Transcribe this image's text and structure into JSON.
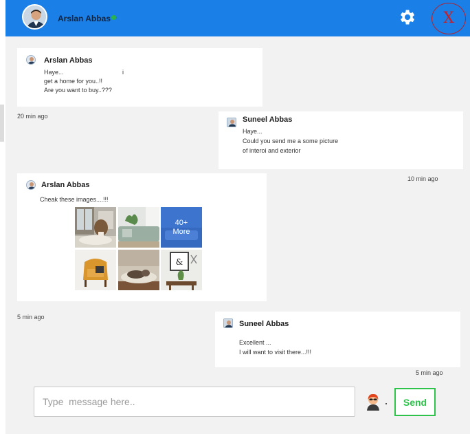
{
  "header": {
    "user_name": "Arslan Abbas",
    "settings_icon": "gear-icon",
    "close_label": "X",
    "accent_color": "#1a80e8",
    "online_color": "#29b34a"
  },
  "messages": [
    {
      "sender": "Arslan Abbas",
      "lines": [
        "Haye...",
        "get a home for you..!!",
        "Are you want to buy..???"
      ],
      "stray_mark": "i",
      "time": "20 min ago"
    },
    {
      "sender": "Suneel Abbas",
      "lines": [
        "Haye...",
        "Could you send me a some picture",
        "of interoi and exterior"
      ],
      "time": "10 min ago"
    },
    {
      "sender": "Arslan Abbas",
      "lines": [
        "Cheak these images....!!!"
      ],
      "gallery": {
        "more_count": "40+",
        "more_label": "More",
        "images": [
          "room-with-rattan-chair",
          "sofa-living-room",
          "more-photos",
          "yellow-armchair",
          "dog-on-cushion",
          "wall-frame-decor"
        ]
      },
      "time": "5 min ago"
    },
    {
      "sender": "Suneel Abbas",
      "lines": [
        "Excellent ...",
        "I will want to visit there...!!!"
      ],
      "time": "5 min ago"
    }
  ],
  "composer": {
    "placeholder": "Type  message here..",
    "emoji_icon": "emoji-face-icon",
    "send_label": "Send",
    "send_color": "#2ec44c"
  }
}
